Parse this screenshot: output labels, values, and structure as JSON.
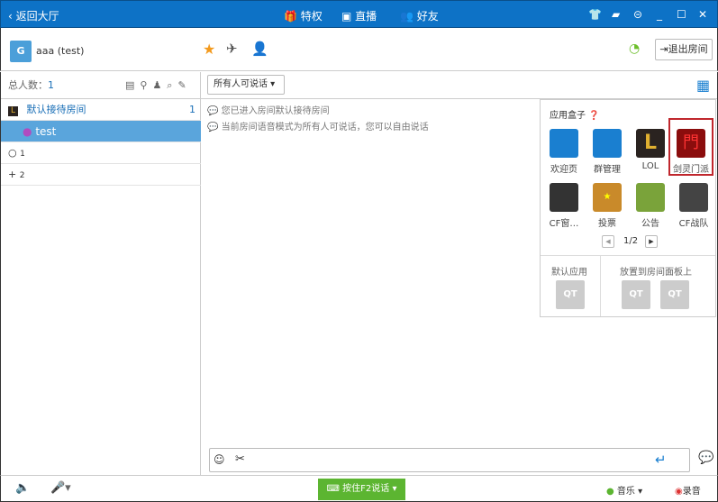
{
  "titlebar": {
    "back": "返回大厅",
    "privilege": "特权",
    "live": "直播",
    "friends": "好友"
  },
  "header": {
    "username": "aaa (test)",
    "exit_room": "退出房间"
  },
  "left": {
    "total_label": "总人数：",
    "total": "1",
    "channels": [
      {
        "name": "默认接待房间",
        "count": "1"
      },
      {
        "name": "test"
      },
      {
        "name": "1"
      },
      {
        "name": "2"
      }
    ]
  },
  "chat": {
    "mode_select": "所有人可说话",
    "messages": [
      "您已进入房间默认接待房间",
      "当前房间语音模式为所有人可说话，您可以自由说话"
    ]
  },
  "appbox": {
    "title": "应用盒子",
    "apps": [
      {
        "label": "欢迎页",
        "color": "#1a7fd0"
      },
      {
        "label": "群管理",
        "color": "#1a7fd0"
      },
      {
        "label": "LOL",
        "color": "#2a2320"
      },
      {
        "label": "剑灵门派",
        "color": "#8b0d0d"
      },
      {
        "label": "CF窗…",
        "color": "#333333"
      },
      {
        "label": "投票",
        "color": "#c98a2a"
      },
      {
        "label": "公告",
        "color": "#7aa33a"
      },
      {
        "label": "CF战队",
        "color": "#444444"
      }
    ],
    "page": "1/2",
    "default_apps": "默认应用",
    "place_on_panel": "放置到房间面板上",
    "qt": "QT",
    "highlight": "#c0272d"
  },
  "bottom": {
    "talk_button": "按住F2说话",
    "music": "音乐",
    "record": "录音"
  },
  "colors": {
    "titlebar": "#0d72c6",
    "selected": "#5aa5dc",
    "talk": "#5cb531"
  }
}
